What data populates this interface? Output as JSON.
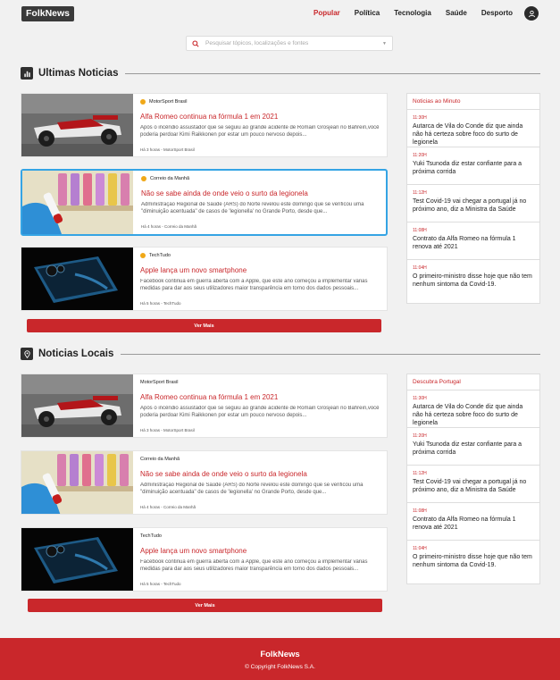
{
  "header": {
    "logo": "FolkNews",
    "nav": [
      "Popular",
      "Política",
      "Tecnologia",
      "Saúde",
      "Desporto"
    ],
    "active_nav": "Popular"
  },
  "search": {
    "placeholder": "Pesquisar tópicos, localizações e fontes"
  },
  "latest": {
    "title": "Ultimas Noticias",
    "cards": [
      {
        "source": "MotorSport Brasil",
        "title": "Alfa Romeo continua na fórmula 1 em 2021",
        "desc": "Após o incêndio assustador que se seguiu ao grande acidente de Romain Grosjean no Bahrein,você poderia perdoar Kimi Raikkonen por estar um pouco nervoso depois...",
        "meta": "Há 3 horas - MotorSport Brasil"
      },
      {
        "source": "Correio da Manhã",
        "title": "Não se sabe ainda de onde veio o surto da legionela",
        "desc": "Administração Regional de Saúde (ARS) do Norte revelou este domingo que se verificou uma \"diminuição acentuada\" de casos de 'legionella' no Grande Porto, desde que...",
        "meta": "Há 4 horas - Correio da Manhã"
      },
      {
        "source": "TechTudo",
        "title": "Apple lança um novo smartphone",
        "desc": "Facebook continua em guerra aberta com a Apple, que este ano começou a implementar várias medidas para dar aos seus utilizadores maior transparência em torno dos dados pessoais...",
        "meta": "Há 5 horas - TechTudo"
      }
    ],
    "more_label": "Ver Mais"
  },
  "local": {
    "title": "Noticias Locais",
    "cards": [
      {
        "source": "MotorSport Brasil",
        "title": "Alfa Romeo continua na fórmula 1 em 2021",
        "desc": "Após o incêndio assustador que se seguiu ao grande acidente de Romain Grosjean no Bahrein,você poderia perdoar Kimi Raikkonen por estar um pouco nervoso depois...",
        "meta": "Há 3 horas - MotorSport Brasil"
      },
      {
        "source": "Correio da Manhã",
        "title": "Não se sabe ainda de onde veio o surto da legionela",
        "desc": "Administração Regional de Saúde (ARS) do Norte revelou este domingo que se verificou uma \"diminuição acentuada\" de casos de 'legionella' no Grande Porto, desde que...",
        "meta": "Há 4 horas - Correio da Manhã"
      },
      {
        "source": "TechTudo",
        "title": "Apple lança um novo smartphone",
        "desc": "Facebook continua em guerra aberta com a Apple, que este ano começou a implementar várias medidas para dar aos seus utilizadores maior transparência em torno dos dados pessoais...",
        "meta": "Há 5 horas - TechTudo"
      }
    ],
    "more_label": "Ver Mais"
  },
  "minute": {
    "title": "Noticias ao Minuto",
    "items": [
      {
        "time": "11:30H",
        "text": "Autarca de Vila do Conde diz que ainda não há certeza sobre foco do surto de legionela"
      },
      {
        "time": "11:20H",
        "text": "Yuki Tsunoda diz estar confiante para a próxima corrida"
      },
      {
        "time": "11:12H",
        "text": "Test Covid-19 vai chegar a portugal já no próximo ano, diz a Ministra da Saúde"
      },
      {
        "time": "11:08H",
        "text": "Contrato da Alfa Romeo na fórmula 1 renova até 2021"
      },
      {
        "time": "11:04H",
        "text": "O primeiro-ministro disse hoje que não tem nenhum sintoma da Covid-19."
      }
    ]
  },
  "discover": {
    "title": "Descubra Portugal",
    "items": [
      {
        "time": "11:30H",
        "text": "Autarca de Vila do Conde diz que ainda não há certeza sobre foco do surto de legionela"
      },
      {
        "time": "11:20H",
        "text": "Yuki Tsunoda diz estar confiante para a próxima corrida"
      },
      {
        "time": "11:12H",
        "text": "Test Covid-19 vai chegar a portugal já no próximo ano, diz a Ministra da Saúde"
      },
      {
        "time": "11:08H",
        "text": "Contrato da Alfa Romeo na fórmula 1 renova até 2021"
      },
      {
        "time": "11:04H",
        "text": "O primeiro-ministro disse hoje que não tem nenhum sintoma da Covid-19."
      }
    ]
  },
  "footer": {
    "title": "FolkNews",
    "copyright": "© Copyright FolkNews S.A."
  },
  "colors": {
    "accent": "#c9272b",
    "selected_border": "#35a4e4",
    "logo_bg": "#3a3a3a"
  }
}
